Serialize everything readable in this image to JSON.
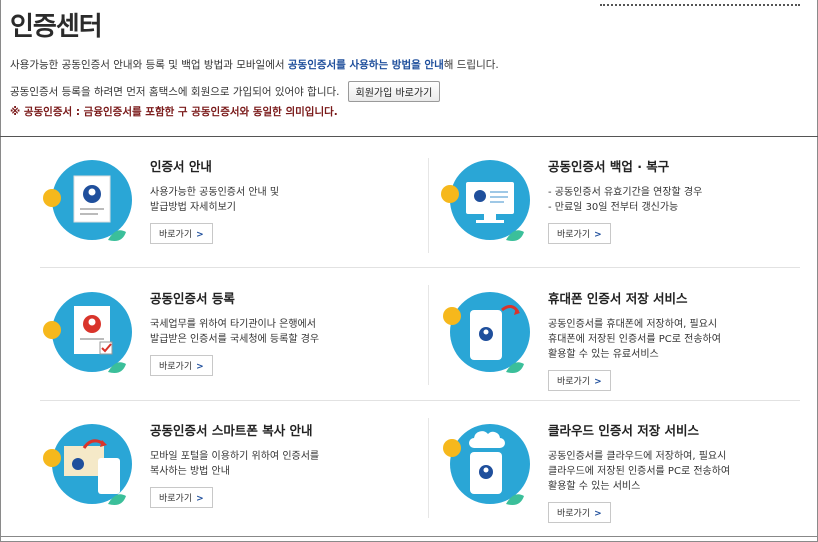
{
  "page": {
    "title": "인증센터"
  },
  "intro": {
    "text_before": "사용가능한 공동인증서 안내와 등록 및 백업 방법과 모바일에서 ",
    "highlight": "공동인증서를 사용하는 방법을 안내",
    "text_after": "해 드립니다."
  },
  "registration": {
    "text": "공동인증서 등록을 하려면 먼저 홈택스에 회원으로 가입되어 있어야 합니다.",
    "button_label": "회원가입 바로가기"
  },
  "note": "※ 공동인증서 : 금융인증서를 포함한 구 공동인증서와 동일한 의미입니다.",
  "colors": {
    "accent_blue": "#1f4f9c",
    "note_red": "#7a1a1a",
    "icon_circle": "#2aa6d6",
    "icon_yellow": "#f6b81c",
    "icon_green": "#3bbf9a"
  },
  "cards": [
    {
      "title": "인증서 안내",
      "desc": [
        "사용가능한 공동인증서 안내 및",
        "발급방법 자세히보기"
      ],
      "button": "바로가기",
      "icon": "certificate-icon"
    },
    {
      "title": "공동인증서 백업 · 복구",
      "desc": [
        "- 공동인증서 유효기간을 연장할 경우",
        "- 만료일 30일 전부터 갱신가능"
      ],
      "button": "바로가기",
      "icon": "monitor-certificate-icon"
    },
    {
      "title": "공동인증서 등록",
      "desc": [
        "국세업무를 위하여 타기관이나 은행에서",
        "발급받은 인증서를 국세청에 등록할 경우"
      ],
      "button": "바로가기",
      "icon": "register-certificate-icon"
    },
    {
      "title": "휴대폰 인증서 저장 서비스",
      "desc": [
        "공동인증서를 휴대폰에 저장하여, 필요시",
        "휴대폰에 저장된 인증서를 PC로 전송하여",
        "활용할 수 있는 유료서비스"
      ],
      "button": "바로가기",
      "icon": "phone-certificate-icon"
    },
    {
      "title": "공동인증서 스마트폰 복사 안내",
      "desc": [
        "모바일 포털을 이용하기 위하여 인증서를",
        "복사하는 방법 안내"
      ],
      "button": "바로가기",
      "icon": "smartphone-copy-icon"
    },
    {
      "title": "클라우드 인증서 저장 서비스",
      "desc": [
        "공동인증서를 클라우드에 저장하여, 필요시",
        "클라우드에 저장된 인증서를 PC로 전송하여",
        "활용할 수 있는 서비스"
      ],
      "button": "바로가기",
      "icon": "cloud-certificate-icon"
    }
  ]
}
